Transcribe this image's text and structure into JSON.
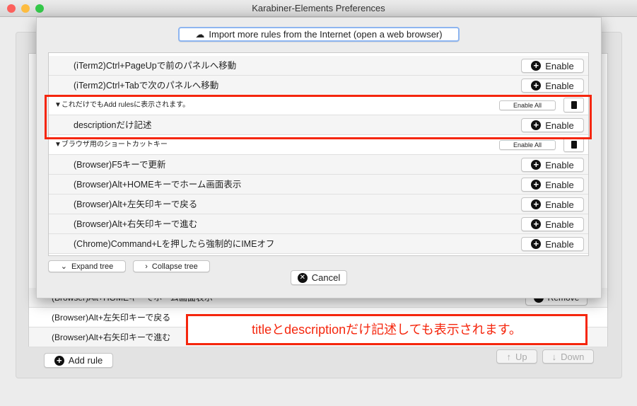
{
  "window": {
    "title": "Karabiner-Elements Preferences"
  },
  "background": {
    "rows": [
      "(Browser)Alt+HOMEキーでホーム画面表示",
      "(Browser)Alt+左矢印キーで戻る",
      "(Browser)Alt+右矢印キーで進む"
    ],
    "remove_label": "Remove",
    "add_rule": "Add rule",
    "up": "Up",
    "down": "Down"
  },
  "sheet": {
    "import_button": "Import more rules from the Internet (open a web browser)",
    "rows": [
      {
        "type": "rule",
        "label": "(iTerm2)Ctrl+PageUpで前のパネルへ移動"
      },
      {
        "type": "rule",
        "label": "(iTerm2)Ctrl+Tabで次のパネルへ移動"
      },
      {
        "type": "group",
        "label": "▼これだけでもAdd rulesに表示されます。"
      },
      {
        "type": "rule",
        "label": "descriptionだけ記述"
      },
      {
        "type": "group",
        "label": "▼ブラウザ用のショートカットキー"
      },
      {
        "type": "rule",
        "label": "(Browser)F5キーで更新"
      },
      {
        "type": "rule",
        "label": "(Browser)Alt+HOMEキーでホーム画面表示"
      },
      {
        "type": "rule",
        "label": "(Browser)Alt+左矢印キーで戻る"
      },
      {
        "type": "rule",
        "label": "(Browser)Alt+右矢印キーで進む"
      },
      {
        "type": "rule",
        "label": "(Chrome)Command+Lを押したら強制的にIMEオフ"
      }
    ],
    "enable_label": "Enable",
    "enable_all_label": "Enable All",
    "expand_tree": "Expand tree",
    "collapse_tree": "Collapse tree",
    "cancel": "Cancel"
  },
  "annotation": {
    "text": "titleとdescriptionだけ記述しても表示されます。",
    "color": "#f5260d"
  }
}
